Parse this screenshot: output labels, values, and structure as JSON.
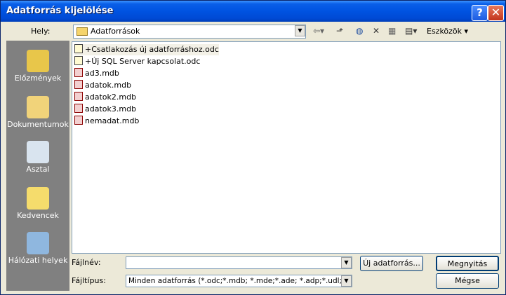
{
  "window": {
    "title": "Adatforrás kijelölése"
  },
  "location": {
    "label": "Hely:",
    "value": "Adatforrások"
  },
  "toolbar": {
    "tools_label": "Eszközök"
  },
  "places": [
    {
      "label": "Előzmények",
      "icon": "history-icon"
    },
    {
      "label": "Dokumentumok",
      "icon": "documents-icon"
    },
    {
      "label": "Asztal",
      "icon": "desktop-icon"
    },
    {
      "label": "Kedvencek",
      "icon": "favorites-icon"
    },
    {
      "label": "Hálózati helyek",
      "icon": "network-icon"
    }
  ],
  "files": [
    {
      "name": "+Csatlakozás új adatforráshoz.odc",
      "type": "odc"
    },
    {
      "name": "+Új SQL Server kapcsolat.odc",
      "type": "odc"
    },
    {
      "name": "ad3.mdb",
      "type": "mdb"
    },
    {
      "name": "adatok.mdb",
      "type": "mdb"
    },
    {
      "name": "adatok2.mdb",
      "type": "mdb"
    },
    {
      "name": "adatok3.mdb",
      "type": "mdb"
    },
    {
      "name": "nemadat.mdb",
      "type": "mdb"
    }
  ],
  "filename": {
    "label": "Fájlnév:",
    "value": ""
  },
  "filetype": {
    "label": "Fájltípus:",
    "value": "Minden adatforrás (*.odc;*.mdb; *.mde;*.ade; *.adp;*.udl;*.dsn"
  },
  "buttons": {
    "new_source": "Új adatforrás...",
    "open": "Megnyitás",
    "cancel": "Mégse"
  }
}
